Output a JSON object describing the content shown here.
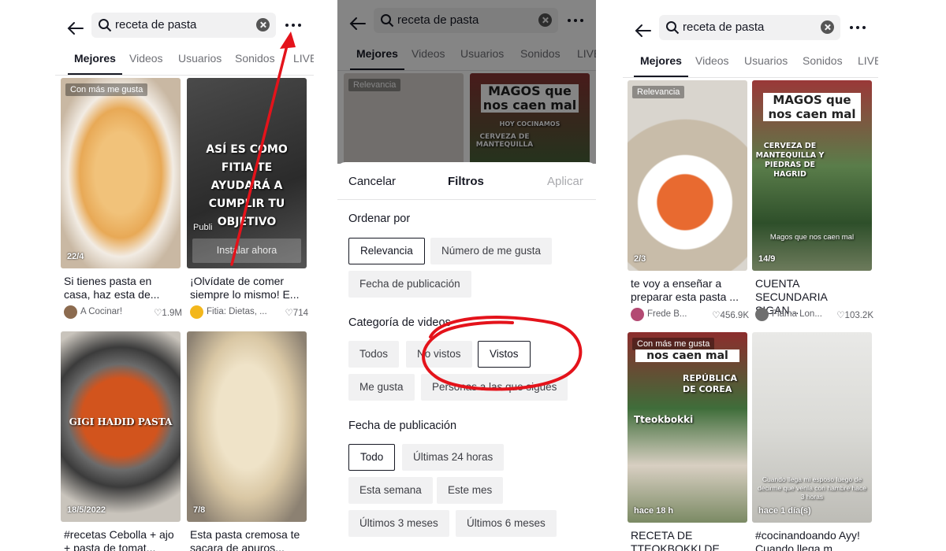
{
  "search": {
    "query": "receta de pasta"
  },
  "tabs": [
    "Mejores",
    "Videos",
    "Usuarios",
    "Sonidos",
    "LIVE"
  ],
  "left": {
    "cards": [
      {
        "tag": "Con más me gusta",
        "date": "22/4",
        "caption": "Si tienes pasta en casa, haz esta de...",
        "author": "A Cocinar!",
        "likes": "♡1.9M",
        "overlay": ""
      },
      {
        "tag": "",
        "date": "",
        "caption": "¡Olvídate de comer siempre lo mismo! E...",
        "author": "Fitia: Dietas, ...",
        "likes": "♡714",
        "overlay": "ASÍ ES COMO FITIA TE AYUDARÁ A CUMPLIR TU OBJETIVO",
        "ad_label": "Publi",
        "install": "Instalar ahora"
      },
      {
        "tag": "",
        "date": "18/5/2022",
        "caption": "#recetas Cebolla + ajo + pasta de tomat...",
        "author": "",
        "likes": "",
        "overlay": "GIGI HADID PASTA"
      },
      {
        "tag": "",
        "date": "7/8",
        "caption": "Esta pasta cremosa te sacara de apuros...",
        "author": "",
        "likes": "",
        "overlay": ""
      }
    ]
  },
  "middle": {
    "bg_tags": [
      "Relevancia"
    ],
    "bg_overlay": [
      "MAGOS que nos caen mal",
      "HOY COCINAMOS",
      "CERVEZA DE MANTEQUILLA"
    ],
    "sheet": {
      "cancel": "Cancelar",
      "title": "Filtros",
      "apply": "Aplicar",
      "sort_title": "Ordenar por",
      "sort_options": [
        "Relevancia",
        "Número de me gusta",
        "Fecha de publicación"
      ],
      "category_title": "Categoría de videos",
      "category_options": [
        "Todos",
        "No vistos",
        "Vistos",
        "Me gusta",
        "Personas a las que sigues"
      ],
      "date_title": "Fecha de publicación",
      "date_options": [
        "Todo",
        "Últimas 24 horas",
        "Esta semana",
        "Este mes",
        "Últimos 3 meses",
        "Últimos 6 meses"
      ]
    }
  },
  "right": {
    "cards": [
      {
        "tag": "Relevancia",
        "date": "2/3",
        "caption": "te voy a enseñar a preparar esta pasta ...",
        "author": "Frede B...",
        "likes": "♡456.9K",
        "overlay": ""
      },
      {
        "tag": "",
        "date": "14/9",
        "caption": "CUENTA SECUNDARIA SIGAN...",
        "author": "Flama Lon...",
        "likes": "♡103.2K",
        "overlay": "MAGOS que nos caen mal",
        "overlay2": "CERVEZA DE MANTEQUILLA Y PIEDRAS DE HAGRID",
        "sub": "Magos que nos caen mal"
      },
      {
        "tag": "Con más me gusta",
        "date": "hace 18 h",
        "caption": "RECETA DE TTEOKBOKKI DE CO...",
        "author": "",
        "likes": "",
        "overlay": "nos caen mal",
        "overlay2": "REPÚBLICA DE COREA",
        "overlay3": "Tteokbokki"
      },
      {
        "tag": "",
        "date": "hace 1 día(s)",
        "caption": "#cocinandoando Ayy! Cuando llega m...",
        "author": "",
        "likes": "",
        "overlay": "Cuando llega mi esposo luego de decirme que venía con hambre hace 3 horas"
      }
    ]
  },
  "colors": {
    "accent": "#fe2c55",
    "annotation": "#e4131b",
    "chip_bg": "#f1f1f2"
  },
  "icons": [
    "back-arrow-icon",
    "search-icon",
    "clear-icon",
    "more-icon",
    "heart-icon"
  ]
}
